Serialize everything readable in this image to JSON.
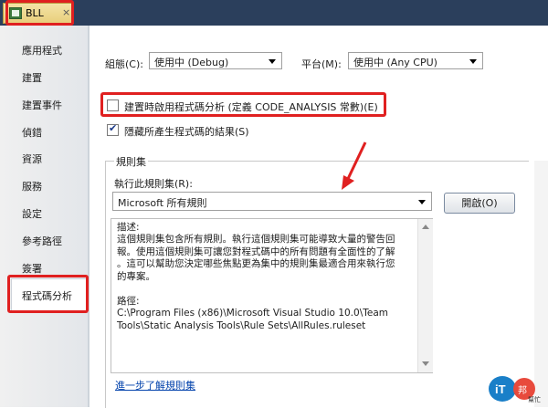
{
  "tab": {
    "title": "BLL",
    "close": "×"
  },
  "sidebar": {
    "items": [
      {
        "label": "應用程式"
      },
      {
        "label": "建置"
      },
      {
        "label": "建置事件"
      },
      {
        "label": "偵錯"
      },
      {
        "label": "資源"
      },
      {
        "label": "服務"
      },
      {
        "label": "設定"
      },
      {
        "label": "參考路徑"
      },
      {
        "label": "簽署"
      },
      {
        "label": "程式碼分析"
      }
    ]
  },
  "config": {
    "config_label": "組態(C):",
    "config_value": "使用中 (Debug)",
    "platform_label": "平台(M):",
    "platform_value": "使用中 (Any CPU)"
  },
  "options": {
    "enable_analysis": "建置時啟用程式碼分析 (定義 CODE_ANALYSIS 常數)(E)",
    "enable_checked": false,
    "suppress": "隱藏所產生程式碼的結果(S)",
    "suppress_checked": true
  },
  "ruleset": {
    "group_title": "規則集",
    "run_label": "執行此規則集(R):",
    "selected": "Microsoft 所有規則",
    "open_button": "開啟(O)",
    "desc_lines": [
      "描述:",
      "這個規則集包含所有規則。執行這個規則集可能導致大量的警告回",
      "報。使用這個規則集可讓您對程式碼中的所有問題有全面性的了解",
      "。這可以幫助您決定哪些焦點更為集中的規則集最適合用來執行您",
      "的專案。",
      "",
      "路徑:",
      "C:\\Program Files (x86)\\Microsoft Visual Studio 10.0\\Team",
      "Tools\\Static Analysis Tools\\Rule Sets\\AllRules.ruleset"
    ],
    "learn_more": "進一步了解規則集"
  },
  "watermark": {
    "text1": "iT",
    "text2": "邦",
    "text3": "幫忙"
  },
  "colors": {
    "highlight": "#e02020",
    "arrow": "#e02020",
    "link": "#0645ad"
  }
}
